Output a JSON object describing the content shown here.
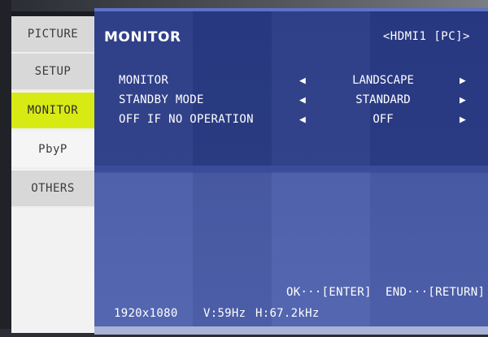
{
  "sidebar": {
    "items": [
      {
        "label": "PICTURE"
      },
      {
        "label": "SETUP"
      },
      {
        "label": "MONITOR"
      },
      {
        "label": "PbyP"
      },
      {
        "label": "OTHERS"
      }
    ],
    "active_index": 2
  },
  "header": {
    "title": "MONITOR",
    "input_source": "<HDMI1 [PC]>"
  },
  "settings": [
    {
      "label": "MONITOR",
      "value": "LANDSCAPE"
    },
    {
      "label": "STANDBY MODE",
      "value": "STANDARD"
    },
    {
      "label": "OFF IF NO OPERATION",
      "value": "OFF"
    }
  ],
  "glyphs": {
    "left": "◀",
    "right": "▶"
  },
  "footer": {
    "ok_hint": "OK···[ENTER]",
    "end_hint": "END···[RETURN]",
    "resolution": "1920x1080",
    "vfreq": "V:59Hz",
    "hfreq": "H:67.2kHz"
  },
  "colors": {
    "panel_blue": "#2c3d86",
    "active_tab": "#d8ea14",
    "sidebar": "#d8d8d8"
  }
}
